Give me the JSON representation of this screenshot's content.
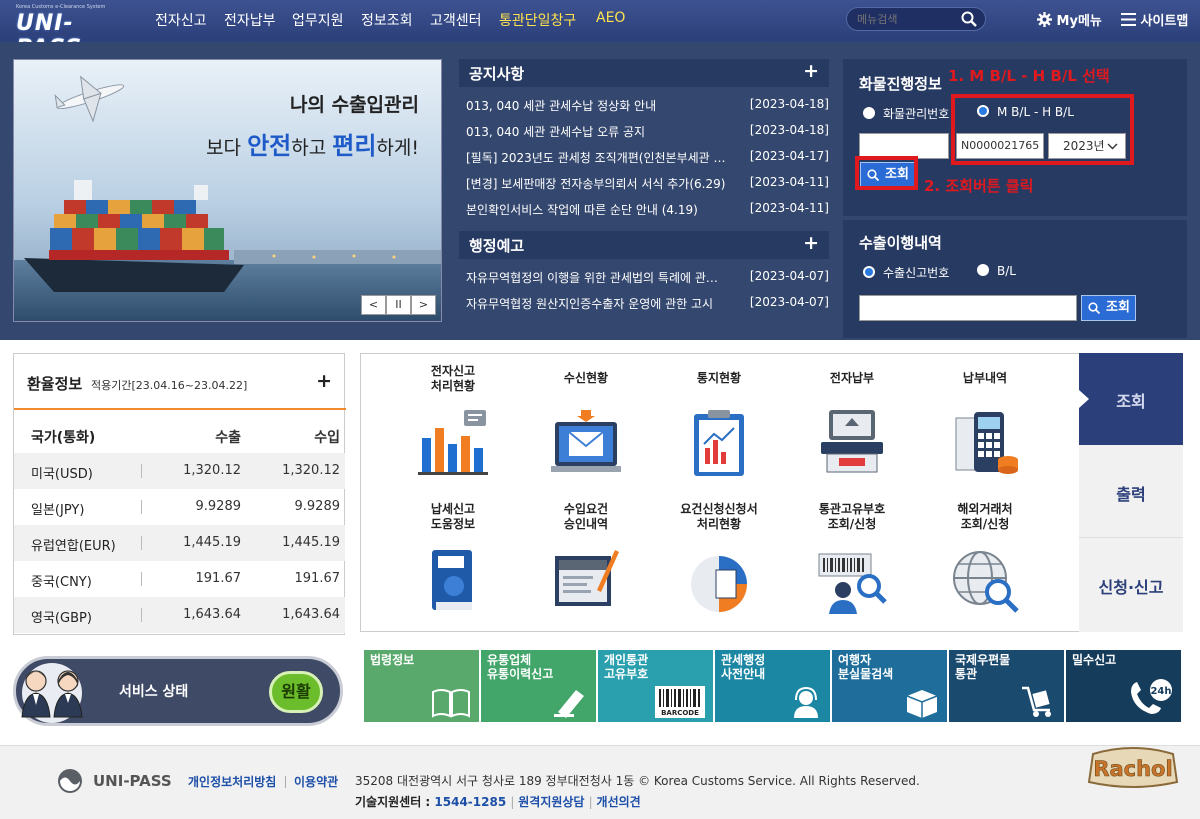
{
  "logo": {
    "small": "Korea Customs e-Clearance System",
    "main": "UNI-PASS"
  },
  "nav": {
    "items": [
      "전자신고",
      "전자납부",
      "업무지원",
      "정보조회",
      "고객센터",
      "통관단일창구",
      "AEO"
    ],
    "search_placeholder": "메뉴검색",
    "mymenu": "My메뉴",
    "sitemap": "사이트맵"
  },
  "banner": {
    "title_line1": "나의 수출입관리",
    "line2_pre": "보다 ",
    "line2_hl1": "안전",
    "line2_mid": "하고 ",
    "line2_hl2": "편리",
    "line2_post": "하게!",
    "prev": "<",
    "pause": "II",
    "next": ">"
  },
  "notice": {
    "title": "공지사항",
    "plus": "+",
    "items": [
      {
        "title": "013, 040 세관 관세수납 정상화 안내",
        "date": "[2023-04-18]"
      },
      {
        "title": "013, 040 세관 관세수납 오류 공지",
        "date": "[2023-04-18]"
      },
      {
        "title": "[필독] 2023년도 관세청 조직개편(인천본부세관 …",
        "date": "[2023-04-17]"
      },
      {
        "title": "[변경] 보세판매장 전자송부의뢰서 서식 추가(6.29)",
        "date": "[2023-04-11]"
      },
      {
        "title": "본인확인서비스 작업에 따른 순단 안내 (4.19)",
        "date": "[2023-04-11]"
      }
    ]
  },
  "admin_notice": {
    "title": "행정예고",
    "plus": "+",
    "items": [
      {
        "title": "자유무역협정의 이행을 위한 관세법의 특례에 관…",
        "date": "[2023-04-07]"
      },
      {
        "title": "자유무역협정 원산지인증수출자 운영에 관한 고시",
        "date": "[2023-04-07]"
      }
    ]
  },
  "cargo": {
    "title": "화물진행정보",
    "radio1": "화물관리번호",
    "radio2": "M B/L - H B/L",
    "bl_value": "N0000021765",
    "year": "2023년",
    "query": "조회",
    "annotation1": "1.  M B/L - H B/L 선택",
    "annotation2": "2. 조회버튼 클릭"
  },
  "export_hist": {
    "title": "수출이행내역",
    "radio1": "수출신고번호",
    "radio2": "B/L",
    "query": "조회"
  },
  "rates": {
    "title": "환율정보",
    "period": "적용기간[23.04.16~23.04.22]",
    "plus": "+",
    "headers": [
      "국가(통화)",
      "수출",
      "수입"
    ],
    "rows": [
      {
        "country": "미국(USD)",
        "export": "1,320.12",
        "import": "1,320.12"
      },
      {
        "country": "일본(JPY)",
        "export": "9.9289",
        "import": "9.9289"
      },
      {
        "country": "유럽연합(EUR)",
        "export": "1,445.19",
        "import": "1,445.19"
      },
      {
        "country": "중국(CNY)",
        "export": "191.67",
        "import": "191.67"
      },
      {
        "country": "영국(GBP)",
        "export": "1,643.64",
        "import": "1,643.64"
      }
    ]
  },
  "service_status": {
    "label": "서비스 상태",
    "value": "원활"
  },
  "menu_grid": [
    {
      "line1": "전자신고",
      "line2": "처리현황",
      "icon": "bar-chart-icon"
    },
    {
      "line1": "수신현황",
      "line2": "",
      "icon": "mail-computer-icon"
    },
    {
      "line1": "통지현황",
      "line2": "",
      "icon": "clipboard-chart-icon"
    },
    {
      "line1": "전자납부",
      "line2": "",
      "icon": "payment-terminal-icon"
    },
    {
      "line1": "납부내역",
      "line2": "",
      "icon": "receipt-calculator-icon"
    },
    {
      "line1": "납세신고",
      "line2": "도움정보",
      "icon": "help-book-icon"
    },
    {
      "line1": "수입요건",
      "line2": "승인내역",
      "icon": "import-document-icon"
    },
    {
      "line1": "요건신청신청서",
      "line2": "처리현황",
      "icon": "pie-document-icon"
    },
    {
      "line1": "통관고유부호",
      "line2": "조회/신청",
      "icon": "barcode-person-icon"
    },
    {
      "line1": "해외거래처",
      "line2": "조회/신청",
      "icon": "globe-search-icon"
    }
  ],
  "side_tabs": [
    "조회",
    "출력",
    "신청·신고"
  ],
  "quick_links": [
    {
      "line1": "법령정보",
      "line2": "",
      "color": "#5aa96c",
      "icon": "book-icon"
    },
    {
      "line1": "유통업체",
      "line2": "유통이력신고",
      "color": "#42a56a",
      "icon": "pen-icon"
    },
    {
      "line1": "개인통관",
      "line2": "고유부호",
      "color": "#2a9fae",
      "icon": "barcode-icon",
      "icon_text": "BARCODE"
    },
    {
      "line1": "관세행정",
      "line2": "사전안내",
      "color": "#1c87a3",
      "icon": "headset-icon"
    },
    {
      "line1": "여행자",
      "line2": "분실물검색",
      "color": "#1e6d9a",
      "icon": "box-icon"
    },
    {
      "line1": "국제우편물",
      "line2": "통관",
      "color": "#1b4a6f",
      "icon": "cart-icon"
    },
    {
      "line1": "밀수신고",
      "line2": "",
      "color": "#163c5c",
      "icon": "phone-24h-icon",
      "icon_text": "24h"
    }
  ],
  "footer": {
    "logo": "UNI-PASS",
    "privacy": "개인정보처리방침",
    "terms": "이용약관",
    "address": "35208 대전광역시 서구 청사로 189 정부대전청사 1동 © Korea Customs Service. All Rights Reserved.",
    "tech_label": "기술지원센터 : ",
    "tech_phone": "1544-1285",
    "remote": "원격지원상담",
    "feedback": "개선의견",
    "rachol": "Rachol"
  },
  "colors": {
    "nav_bg": "#2b3f7a",
    "hero_bg": "#34476e",
    "accent_orange": "#f08a2c",
    "annotation_red": "#e0191f",
    "query_blue": "#2b6bd5"
  }
}
